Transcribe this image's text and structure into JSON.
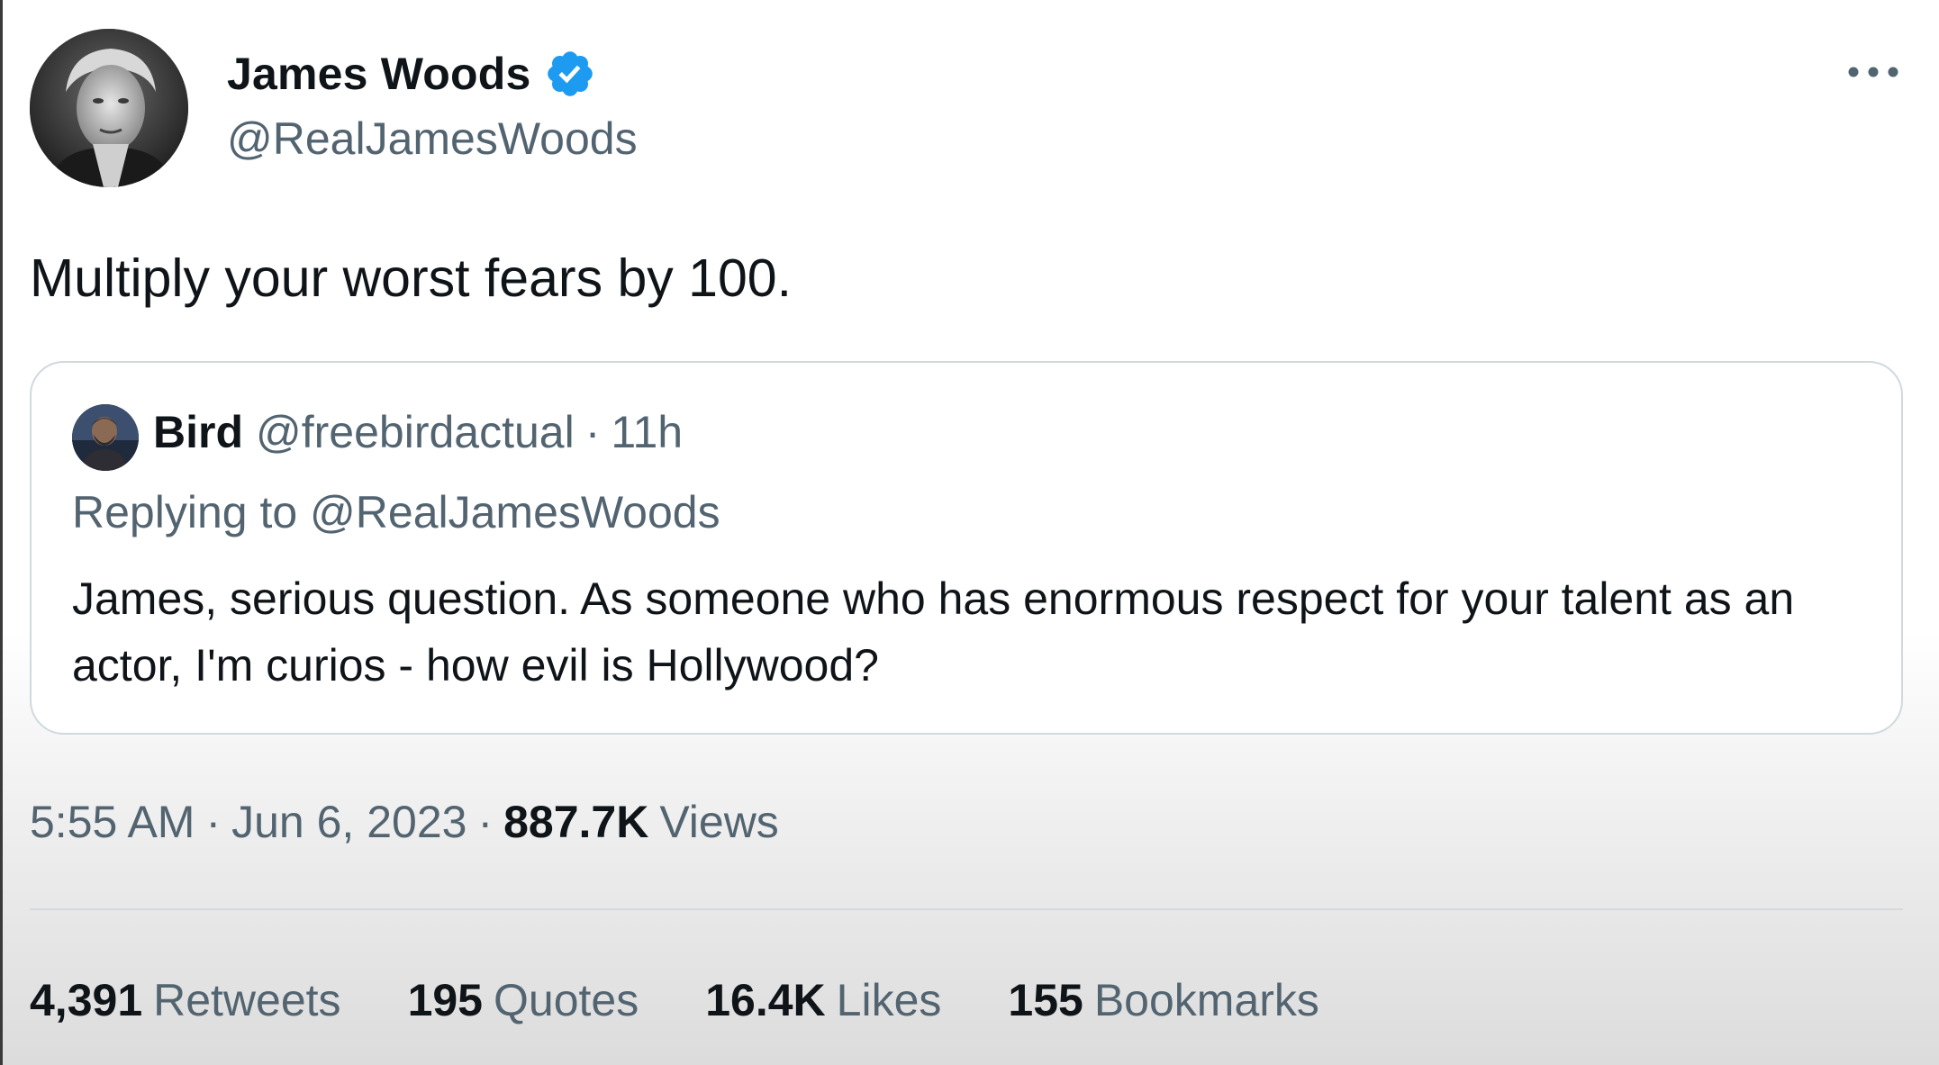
{
  "author": {
    "display_name": "James Woods",
    "handle": "@RealJamesWoods",
    "avatar_icon": "user-avatar-icon",
    "verified_icon": "verified-badge-icon",
    "verified_color": "#1d9bf0"
  },
  "more_icon": "more-options-icon",
  "tweet": {
    "text": "Multiply your worst fears by 100."
  },
  "quote": {
    "avatar_icon": "user-avatar-icon",
    "display_name": "Bird",
    "handle": "@freebirdactual",
    "separator": "·",
    "time": "11h",
    "replying_to": "Replying to @RealJamesWoods",
    "text": "James, serious question. As someone who has enormous respect for your talent as an actor, I'm curios - how evil is Hollywood?"
  },
  "meta": {
    "time": "5:55 AM",
    "separator": "·",
    "date": "Jun 6, 2023",
    "views_count": "887.7K",
    "views_label": "Views"
  },
  "stats": [
    {
      "count": "4,391",
      "label": "Retweets"
    },
    {
      "count": "195",
      "label": "Quotes"
    },
    {
      "count": "16.4K",
      "label": "Likes"
    },
    {
      "count": "155",
      "label": "Bookmarks"
    }
  ],
  "colors": {
    "text_primary": "#0f1419",
    "text_secondary": "#536471",
    "border": "#cfd9de"
  }
}
